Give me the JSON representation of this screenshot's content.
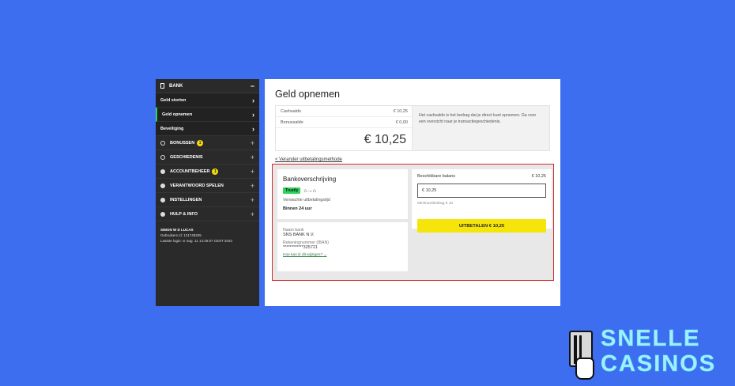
{
  "sidebar": {
    "bank_label": "BANK",
    "sub_items": [
      {
        "label": "Geld storten"
      },
      {
        "label": "Geld opnemen"
      },
      {
        "label": "Beveiliging"
      }
    ],
    "main_items": [
      {
        "label": "BONUSSEN",
        "badge": "1"
      },
      {
        "label": "GESCHIEDENIS"
      },
      {
        "label": "ACCOUNTBEHEER",
        "badge": "1"
      },
      {
        "label": "VERANTWOORD SPELEN"
      },
      {
        "label": "INSTELLINGEN"
      },
      {
        "label": "HULP & INFO"
      }
    ],
    "user": {
      "name": "SIMON W D LUCAS",
      "id_line": "Gebruikers id: 121748205",
      "login_line": "Laatste login: vr aug. 11 14:26:07 CEST 2023"
    }
  },
  "main": {
    "title": "Geld opnemen",
    "balances": {
      "cash_label": "Cashsaldo",
      "cash_value": "€ 10,25",
      "bonus_label": "Bonussaldo",
      "bonus_value": "€ 0,00",
      "total": "€ 10,25"
    },
    "info_text": "Het cashsaldo is het bedrag dat je direct kunt opnemen. Ga voor een overzicht naar je transactiegeschiedenis.",
    "change_method": "< Verander uitbetalingsmethode",
    "method": {
      "title": "Bankoverschrijving",
      "provider": "Trustly",
      "expected_label": "Verwachte uitbetalingstijd",
      "expected_value": "Binnen 24 uur",
      "bank_name_label": "Naam bank",
      "bank_name_value": "SNS BANK N.V.",
      "iban_label": "Rekeningnummer (IBAN)",
      "iban_value": "************325721",
      "how_link": "Hoe kan ik dit wijzigen?"
    },
    "withdraw": {
      "available_label": "Beschikbare balans",
      "available_value": "€ 10,25",
      "amount_value": "€ 10,25",
      "min_text": "Minimumbedrag € 10",
      "button_label": "UITBETALEN € 10,25"
    }
  },
  "logo": {
    "line1": "SNELLE",
    "line2": "CASINOS"
  }
}
